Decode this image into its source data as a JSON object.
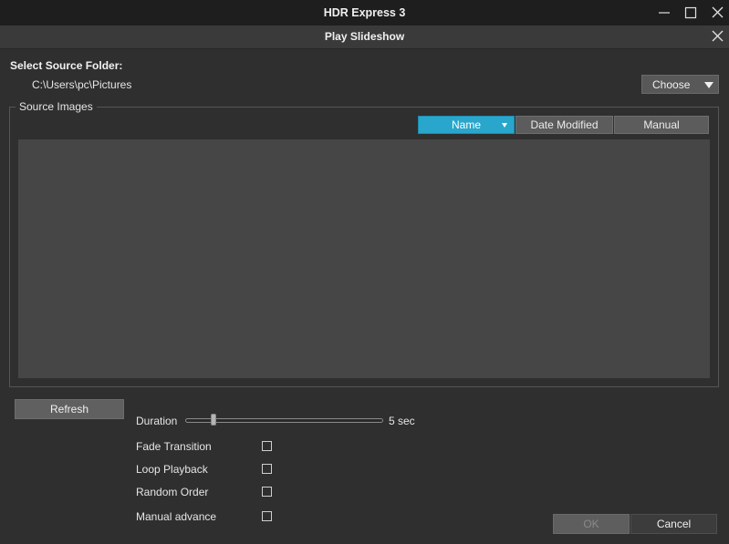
{
  "window": {
    "title": "HDR Express 3"
  },
  "dialog": {
    "title": "Play Slideshow"
  },
  "source": {
    "label": "Select Source Folder:",
    "path": "C:\\Users\\pc\\Pictures",
    "choose_label": "Choose"
  },
  "images": {
    "group_label": "Source Images",
    "sort_tabs": [
      {
        "label": "Name",
        "active": true
      },
      {
        "label": "Date Modified",
        "active": false
      },
      {
        "label": "Manual",
        "active": false
      }
    ]
  },
  "refresh_label": "Refresh",
  "duration": {
    "label": "Duration",
    "value_text": "5 sec",
    "value": 5
  },
  "options": [
    {
      "label": "Fade Transition",
      "checked": false
    },
    {
      "label": "Loop Playback",
      "checked": false
    },
    {
      "label": "Random Order",
      "checked": false
    },
    {
      "label": "Manual advance",
      "checked": false
    }
  ],
  "buttons": {
    "ok_label": "OK",
    "cancel_label": "Cancel"
  },
  "colors": {
    "accent": "#29a6cc",
    "background": "#2f2f2f",
    "titlebar": "#1e1e1e"
  },
  "icons": {
    "minimize": "minimize-icon",
    "maximize": "maximize-icon",
    "close": "close-icon",
    "dropdown": "chevron-down-icon"
  }
}
